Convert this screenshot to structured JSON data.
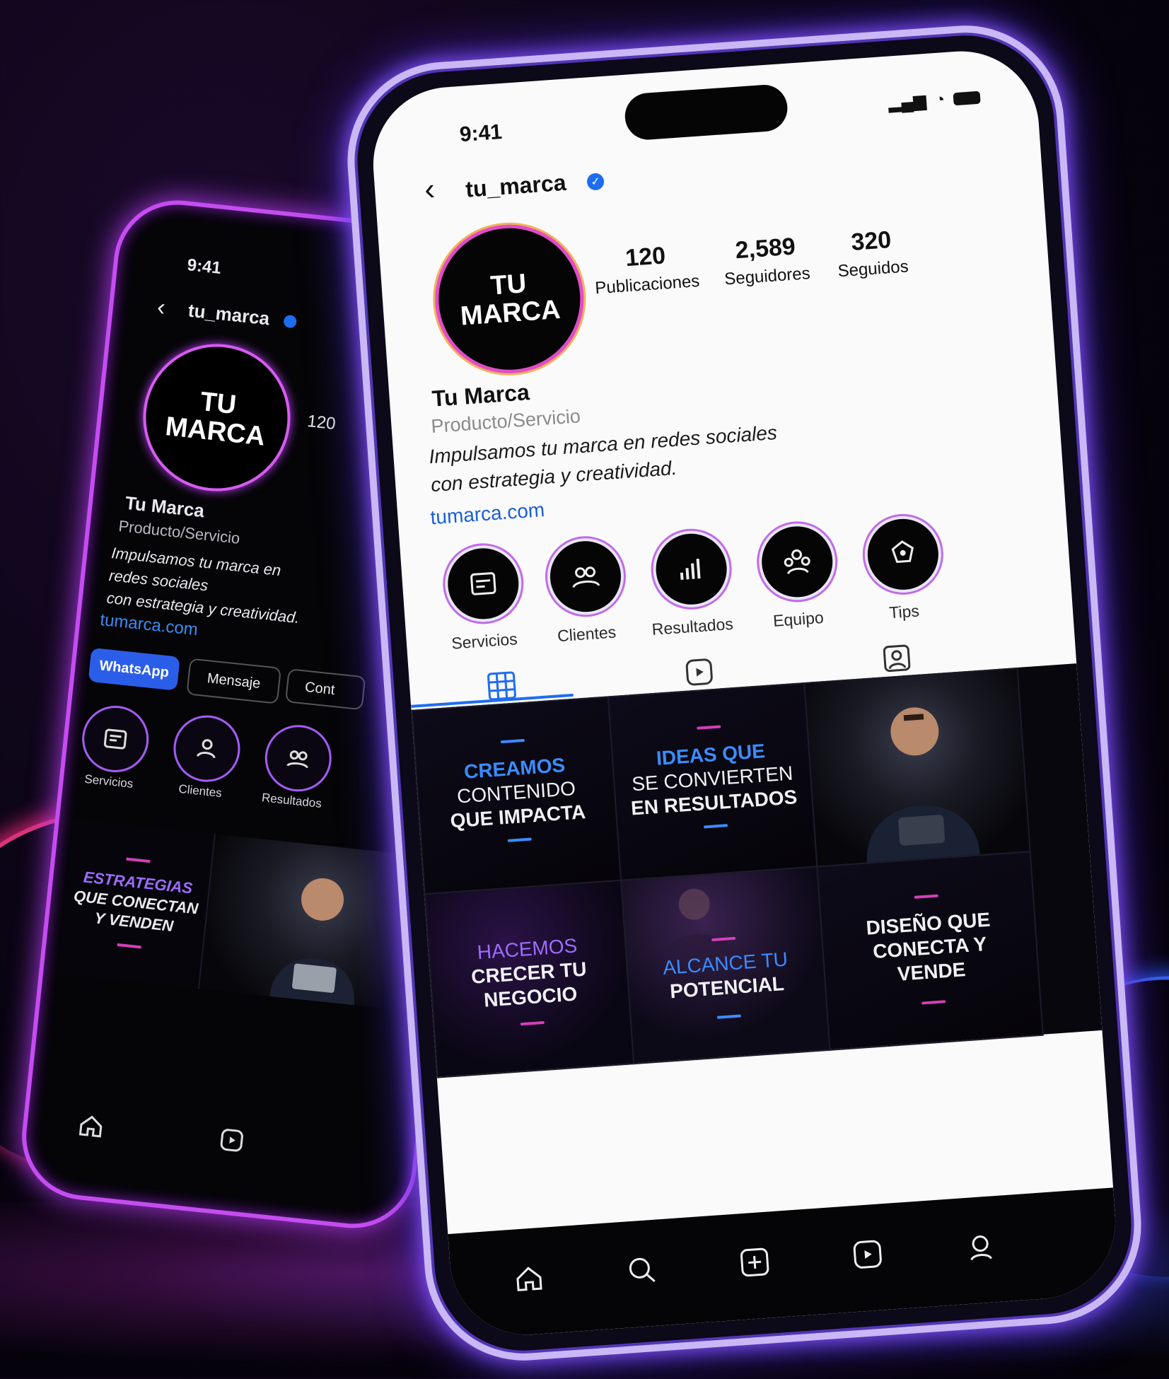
{
  "back_phone": {
    "time": "9:41",
    "username": "tu_marca",
    "avatar": {
      "line1": "TU",
      "line2": "MARCA"
    },
    "publicaciones_count": "120",
    "name": "Tu Marca",
    "category": "Producto/Servicio",
    "bio_line1": "Impulsamos tu marca en",
    "bio_line2": "redes sociales",
    "bio_line3": "con estrategia y creatividad.",
    "link": "tumarca.com",
    "buttons": {
      "whatsapp": "WhatsApp",
      "mensaje": "Mensaje",
      "contacto": "Cont"
    },
    "highlights": [
      {
        "label": "Servicios",
        "icon": "services-icon"
      },
      {
        "label": "Clientes",
        "icon": "clients-icon"
      },
      {
        "label": "Resultados",
        "icon": "results-icon"
      }
    ],
    "post": {
      "line1": "ESTRATEGIAS",
      "line2": "QUE CONECTAN",
      "line3": "Y VENDEN"
    }
  },
  "front_phone": {
    "time": "9:41",
    "username": "tu_marca",
    "avatar": {
      "line1": "TU",
      "line2": "MARCA"
    },
    "stats": [
      {
        "number": "120",
        "label": "Publicaciones"
      },
      {
        "number": "2,589",
        "label": "Seguidores"
      },
      {
        "number": "320",
        "label": "Seguidos"
      }
    ],
    "name": "Tu Marca",
    "category": "Producto/Servicio",
    "bio_line1": "Impulsamos tu marca en redes sociales",
    "bio_line2": "con estrategia y creatividad.",
    "link": "tumarca.com",
    "highlights": [
      {
        "label": "Servicios",
        "icon": "services-icon"
      },
      {
        "label": "Clientes",
        "icon": "clients-icon"
      },
      {
        "label": "Resultados",
        "icon": "results-icon"
      },
      {
        "label": "Equipo",
        "icon": "team-icon"
      },
      {
        "label": "Tips",
        "icon": "tips-icon"
      }
    ],
    "posts": [
      {
        "line1": "CREAMOS",
        "line2": "CONTENIDO",
        "line3": "QUE IMPACTA"
      },
      {
        "line1": "IDEAS QUE",
        "line2": "SE CONVIERTEN",
        "line3": "EN RESULTADOS"
      },
      {
        "line1": "HACEMOS",
        "line2": "CRECER TU",
        "line3": "NEGOCIO"
      },
      {
        "line1": "ALCANCE TU",
        "line2": "POTENCIAL"
      },
      {
        "line1": "DISEÑO QUE",
        "line2": "CONECTA Y",
        "line3": "VENDE"
      }
    ]
  },
  "colors": {
    "accent_blue": "#1e6df0",
    "neon_purple": "#c54df0",
    "neon_blue": "#4d2bd8"
  }
}
